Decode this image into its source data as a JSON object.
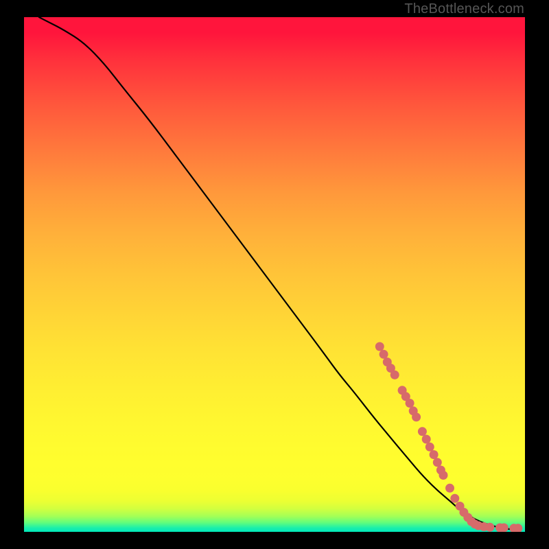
{
  "watermark": "TheBottleneck.com",
  "colors": {
    "background": "#000000",
    "curve": "#000000",
    "marker": "#d76a6a",
    "gradient_top": "#ff153c",
    "gradient_bottom": "#00e8bb"
  },
  "chart_data": {
    "type": "line",
    "title": "",
    "xlabel": "",
    "ylabel": "",
    "xlim": [
      0,
      100
    ],
    "ylim": [
      0,
      100
    ],
    "grid": false,
    "legend": false,
    "curve": {
      "note": "Single descending curve; y read as percent of plot height from bottom, x as percent from left.",
      "x": [
        3,
        5,
        8,
        12,
        16,
        20,
        25,
        30,
        35,
        40,
        45,
        50,
        55,
        60,
        63,
        66,
        70,
        73,
        76,
        79,
        82,
        85,
        87,
        89,
        91,
        93,
        95,
        97,
        99
      ],
      "y": [
        100,
        99,
        97.5,
        95,
        91,
        86,
        80,
        73.5,
        67,
        60.5,
        54,
        47.5,
        41,
        34.5,
        30.5,
        27,
        22,
        18.5,
        15,
        11.5,
        8.5,
        6,
        4.3,
        3,
        2,
        1.3,
        0.8,
        0.5,
        0.4
      ]
    },
    "markers": {
      "note": "Highlighted data points (salmon dots) along the lower-right portion of the curve; same coordinate convention.",
      "points": [
        {
          "x": 71.0,
          "y": 36.0
        },
        {
          "x": 71.8,
          "y": 34.5
        },
        {
          "x": 72.5,
          "y": 33.0
        },
        {
          "x": 73.2,
          "y": 31.8
        },
        {
          "x": 74.0,
          "y": 30.5
        },
        {
          "x": 75.5,
          "y": 27.5
        },
        {
          "x": 76.2,
          "y": 26.3
        },
        {
          "x": 77.0,
          "y": 25.0
        },
        {
          "x": 77.7,
          "y": 23.5
        },
        {
          "x": 78.3,
          "y": 22.3
        },
        {
          "x": 79.5,
          "y": 19.5
        },
        {
          "x": 80.3,
          "y": 18.0
        },
        {
          "x": 81.0,
          "y": 16.5
        },
        {
          "x": 81.8,
          "y": 15.0
        },
        {
          "x": 82.5,
          "y": 13.5
        },
        {
          "x": 83.2,
          "y": 12.0
        },
        {
          "x": 83.7,
          "y": 11.0
        },
        {
          "x": 85.0,
          "y": 8.5
        },
        {
          "x": 86.0,
          "y": 6.5
        },
        {
          "x": 87.0,
          "y": 5.0
        },
        {
          "x": 87.8,
          "y": 3.8
        },
        {
          "x": 88.6,
          "y": 2.8
        },
        {
          "x": 89.3,
          "y": 2.0
        },
        {
          "x": 90.0,
          "y": 1.5
        },
        {
          "x": 90.7,
          "y": 1.2
        },
        {
          "x": 91.8,
          "y": 1.0
        },
        {
          "x": 93.0,
          "y": 0.9
        },
        {
          "x": 95.0,
          "y": 0.8
        },
        {
          "x": 95.8,
          "y": 0.8
        },
        {
          "x": 97.8,
          "y": 0.7
        },
        {
          "x": 98.6,
          "y": 0.7
        }
      ]
    }
  }
}
